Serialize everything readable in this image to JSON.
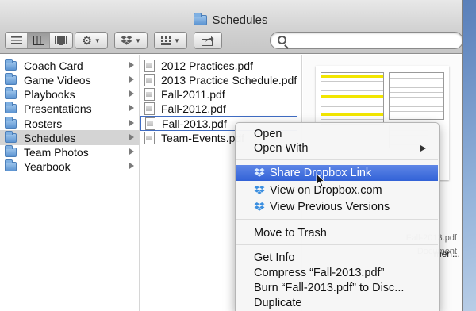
{
  "window": {
    "title": "Schedules"
  },
  "toolbar": {
    "view_buttons": [
      "icon-view",
      "column-view",
      "cover-flow-view"
    ],
    "active_view": "column-view",
    "action_icon": "gear-icon",
    "dropbox_icon": "dropbox-icon",
    "arrange_icon": "grid-icon",
    "share_icon": "share-icon"
  },
  "search": {
    "value": "",
    "placeholder": ""
  },
  "sidebar_column": {
    "items": [
      {
        "label": "Coach Card"
      },
      {
        "label": "Game Videos"
      },
      {
        "label": "Playbooks"
      },
      {
        "label": "Presentations"
      },
      {
        "label": "Rosters"
      },
      {
        "label": "Schedules"
      },
      {
        "label": "Team Photos"
      },
      {
        "label": "Yearbook"
      }
    ],
    "selected": "Schedules"
  },
  "files_column": {
    "items": [
      {
        "label": "2012 Practices.pdf"
      },
      {
        "label": "2013 Practice Schedule.pdf"
      },
      {
        "label": "Fall-2011.pdf"
      },
      {
        "label": "Fall-2012.pdf"
      },
      {
        "label": "Fall-2013.pdf"
      },
      {
        "label": "Team-Events.pdf"
      }
    ],
    "selected": "Fall-2013.pdf"
  },
  "preview": {
    "ghost_lines": [
      "Fall-2013.pdf",
      "Document",
      "men..."
    ]
  },
  "context_menu": {
    "items": [
      {
        "label": "Open",
        "icon": ""
      },
      {
        "label": "Open With",
        "icon": "",
        "submenu": true
      },
      {
        "label": "Share Dropbox Link",
        "icon": "dropbox-icon",
        "highlighted": true
      },
      {
        "label": "View on Dropbox.com",
        "icon": "dropbox-icon"
      },
      {
        "label": "View Previous Versions",
        "icon": "dropbox-icon"
      },
      {
        "label": "Move to Trash",
        "icon": ""
      },
      {
        "label": "Get Info",
        "icon": ""
      },
      {
        "label": "Compress “Fall-2013.pdf”",
        "icon": ""
      },
      {
        "label": "Burn “Fall-2013.pdf” to Disc...",
        "icon": ""
      },
      {
        "label": "Duplicate",
        "icon": ""
      }
    ],
    "highlight_color": "#3c6cdb"
  }
}
